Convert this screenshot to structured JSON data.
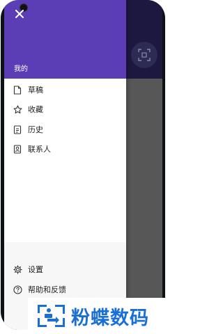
{
  "drawer": {
    "header_label": "我的",
    "menu": [
      {
        "label": "草稿",
        "icon": "draft-file-icon"
      },
      {
        "label": "收藏",
        "icon": "star-icon"
      },
      {
        "label": "历史",
        "icon": "history-icon"
      },
      {
        "label": "联系人",
        "icon": "contact-icon"
      }
    ],
    "bottom_menu": [
      {
        "label": "设置",
        "icon": "gear-icon"
      },
      {
        "label": "帮助和反馈",
        "icon": "help-icon"
      }
    ]
  },
  "watermark": {
    "text": "粉蝶数码"
  },
  "colors": {
    "drawer_header": "#5b3db5",
    "background_header": "#1c1840",
    "scrim": "#575757",
    "watermark_text": "#1a6fd6"
  }
}
